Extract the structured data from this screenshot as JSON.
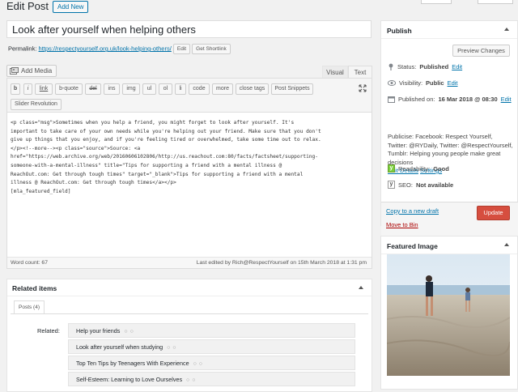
{
  "header": {
    "title": "Edit Post",
    "add_new": "Add New"
  },
  "post": {
    "title": "Look after yourself when helping others",
    "permalink_label": "Permalink:",
    "permalink_url": "https://respectyourself.org.uk/look-helping-others/",
    "edit_btn": "Edit",
    "shortlink_btn": "Get Shortlink"
  },
  "editor": {
    "add_media": "Add Media",
    "tab_visual": "Visual",
    "tab_text": "Text",
    "toolbar_row1": [
      "b",
      "i",
      "link",
      "b-quote",
      "del",
      "ins",
      "img",
      "ul",
      "ol",
      "li",
      "code",
      "more",
      "close tags",
      "Post Snippets"
    ],
    "toolbar_row2": [
      "Slider Revolution"
    ],
    "content_lines": [
      "<p class=\"msg\">Sometimes when you help a friend, you might forget to look after yourself. It's",
      "important to take care of your own needs while you're helping out your friend. Make sure that you don't",
      "give up things that you enjoy, and if you're feeling tired or overwhelmed, take some time out to relax.",
      "</p><!--more--><p class=\"source\">Source: <a",
      "href=\"https://web.archive.org/web/20160606102806/http://us.reachout.com:80/facts/factsheet/supporting-",
      "someone-with-a-mental-illness\" title=\"Tips for supporting a friend with a mental illness @",
      "ReachOut.com: Get through tough times\" target=\"_blank\">Tips for supporting a friend with a mental",
      "illness @ ReachOut.com: Get through tough times</a></p>",
      "[mla_featured_field]"
    ],
    "word_count": "Word count: 67",
    "last_edited": "Last edited by Rich@RespectYourself on 15th March 2018 at 1:31 pm"
  },
  "related": {
    "heading": "Related items",
    "tab": "Posts (4)",
    "label": "Related:",
    "items": [
      "Help your friends",
      "Look after yourself when studying",
      "Top Ten Tips by Teenagers With Experience",
      "Self-Esteem: Learning to Love Ourselves"
    ]
  },
  "publish": {
    "heading": "Publish",
    "preview": "Preview Changes",
    "status_label": "Status:",
    "status_value": "Published",
    "visibility_label": "Visibility:",
    "visibility_value": "Public",
    "published_on_label": "Published on:",
    "published_on_value": "16 Mar 2018 @ 08:30",
    "edit_link": "Edit",
    "publicise_text": "Publicise: Facebook: Respect Yourself, Twitter: @RYDaily, Twitter: @RespectYourself, Tumblr: Helping young people make great decisions",
    "edit_details": "Edit Details",
    "settings": "Settings",
    "readability_label": "Readability:",
    "readability_value": "Good",
    "seo_label": "SEO:",
    "seo_value": "Not available",
    "copy_draft": "Copy to a new draft",
    "move_trash": "Move to Bin",
    "update": "Update"
  },
  "featured": {
    "heading": "Featured Image"
  },
  "colors": {
    "accent": "#0073aa",
    "update": "#d64e3f",
    "readability": "#7ad03a"
  }
}
